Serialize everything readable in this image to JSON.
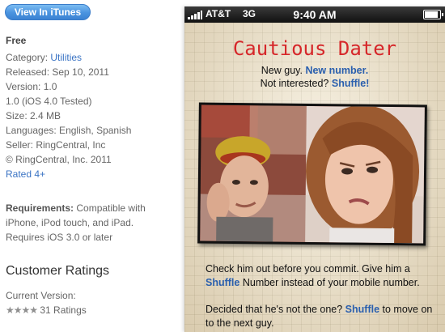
{
  "store": {
    "view_button": "View In iTunes",
    "price": "Free",
    "meta": {
      "category_label": "Category:",
      "category_value": "Utilities",
      "released": "Released: Sep 10, 2011",
      "version": "Version: 1.0",
      "ios_tested": "1.0 (iOS 4.0 Tested)",
      "size": "Size: 2.4 MB",
      "languages": "Languages: English, Spanish",
      "seller": "Seller: RingCentral, Inc",
      "copyright": "© RingCentral, Inc. 2011",
      "rating": "Rated 4+"
    },
    "requirements_label": "Requirements:",
    "requirements_text": "Compatible with iPhone, iPod touch, and iPad. Requires iOS 3.0 or later",
    "ratings_heading": "Customer Ratings",
    "current_version_label": "Current Version:",
    "stars": "★★★★",
    "ratings_count": "31 Ratings"
  },
  "phone": {
    "status_bar": {
      "carrier": "AT&T",
      "network": "3G",
      "time": "9:40 AM"
    },
    "app_title": "Cautious Dater",
    "tagline_1_plain": "New guy.",
    "tagline_1_highlight": "New number.",
    "tagline_2_plain": "Not interested?",
    "tagline_2_highlight": "Shuffle!",
    "body_1_a": "Check him out before you commit. Give him a",
    "body_1_highlight": "Shuffle",
    "body_1_b": "Number instead of your mobile number.",
    "body_2_a": "Decided that he's not the one?",
    "body_2_highlight": "Shuffle",
    "body_2_b": "to move on to the next guy."
  },
  "colors": {
    "link_blue": "#3b74c4",
    "title_red": "#d6272a",
    "highlight_blue": "#2a5fae",
    "itunes_button": "#4a93df"
  }
}
